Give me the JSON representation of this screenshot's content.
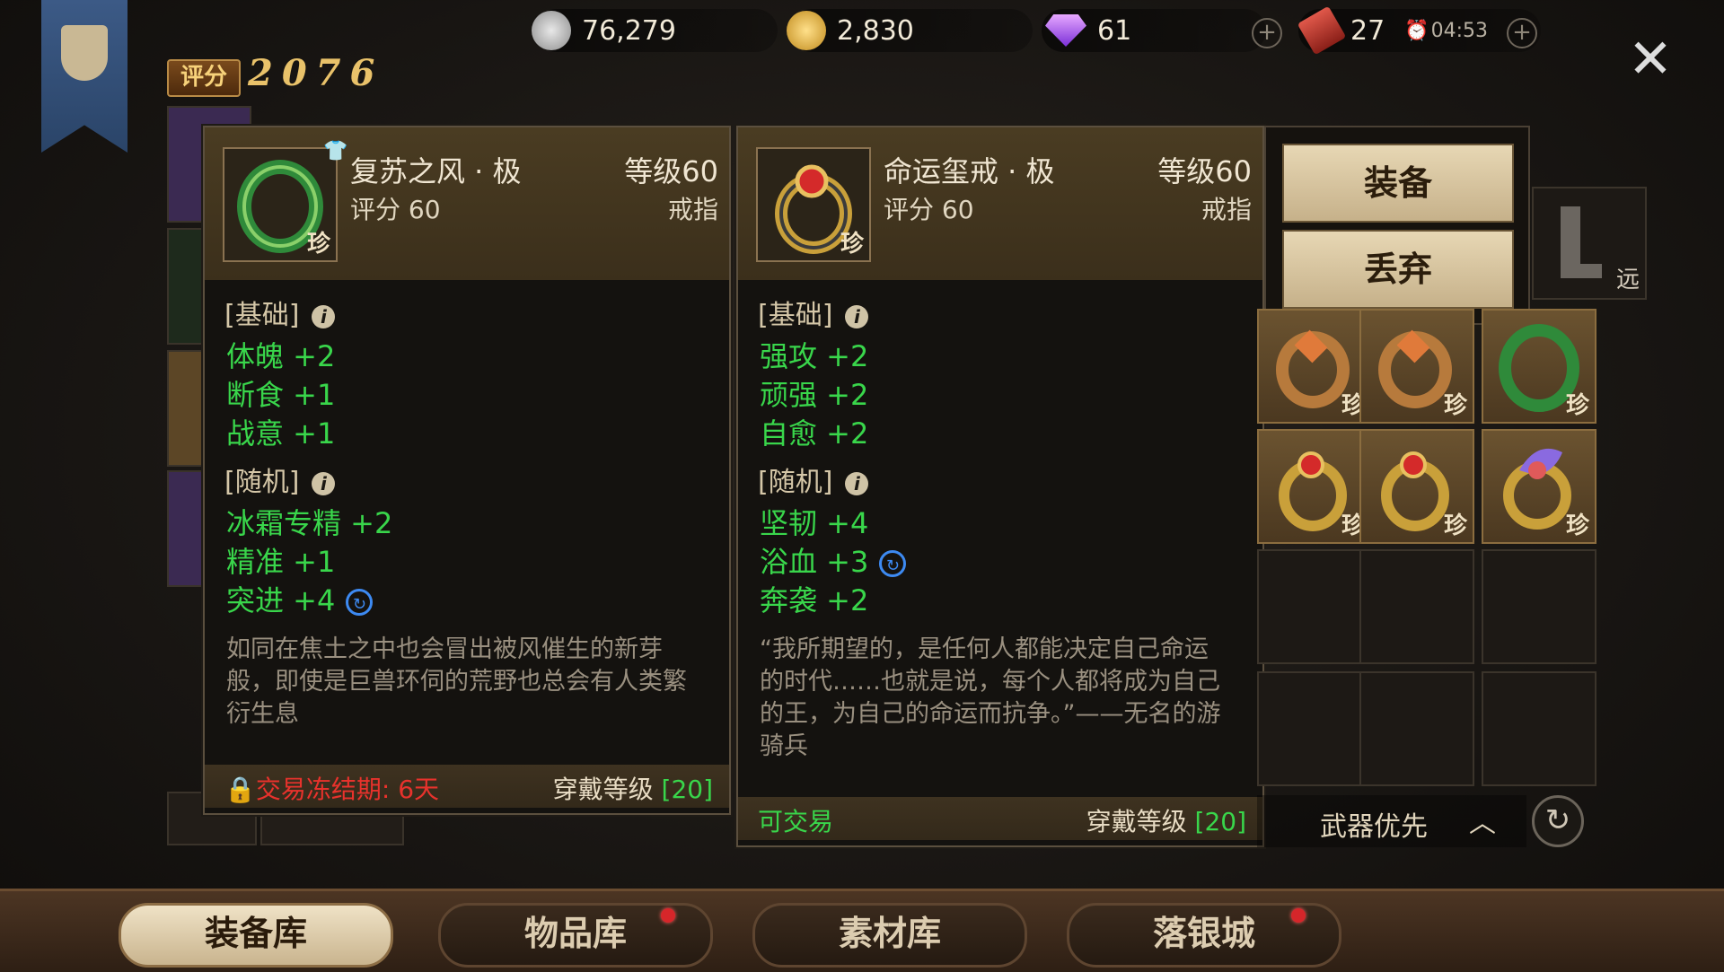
{
  "currencies": {
    "silver": "76,279",
    "gold": "2,830",
    "diamond": "61",
    "stamina": "27",
    "timer": "04:53"
  },
  "player": {
    "score_label": "评分",
    "score_value": "2076"
  },
  "panel_left": {
    "name": "复苏之风 · 极",
    "level": "等级60",
    "score": "评分 60",
    "type": "戒指",
    "rarity": "珍",
    "basic_header": "[基础]",
    "basic_stats": [
      "体魄 +2",
      "断食 +1",
      "战意 +1"
    ],
    "random_header": "[随机]",
    "random_stats": [
      "冰霜专精 +2",
      "精准 +1",
      "突进 +4"
    ],
    "description": "如同在焦土之中也会冒出被风催生的新芽般，即使是巨兽环伺的荒野也总会有人类繁衍生息",
    "trade_status": "交易冻结期: 6天",
    "wear_level_label": "穿戴等级",
    "wear_level_value": "[20]"
  },
  "panel_right": {
    "name": "命运玺戒 · 极",
    "level": "等级60",
    "score": "评分 60",
    "type": "戒指",
    "rarity": "珍",
    "basic_header": "[基础]",
    "basic_stats": [
      "强攻 +2",
      "顽强 +2",
      "自愈 +2"
    ],
    "random_header": "[随机]",
    "random_stats": [
      "坚韧 +4",
      "浴血 +3",
      "奔袭 +2"
    ],
    "description": "“我所期望的，是任何人都能决定自己命运的时代……也就是说，每个人都将成为自己的王，为自己的命运而抗争。”——无名的游骑兵",
    "trade_status": "可交易",
    "wear_level_label": "穿戴等级",
    "wear_level_value": "[20]"
  },
  "actions": {
    "equip": "装备",
    "discard": "丢弃"
  },
  "inventory": {
    "rarity_mark": "珍",
    "ranged_mark": "远",
    "sort_label": "武器优先"
  },
  "tabs": [
    "装备库",
    "物品库",
    "素材库",
    "落银城"
  ],
  "colors": {
    "stat_green": "#39d64b",
    "frozen_red": "#e8322c",
    "accent_gold": "#e9c26a"
  }
}
